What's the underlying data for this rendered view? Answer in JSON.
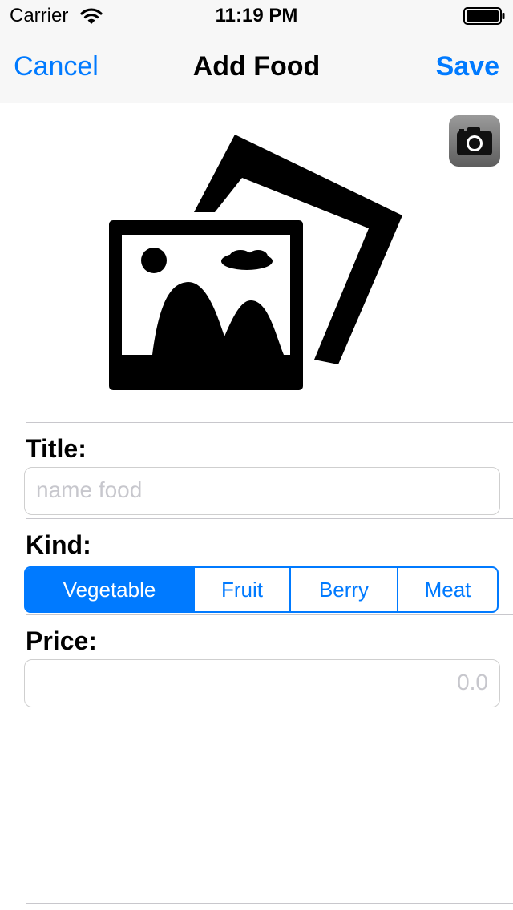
{
  "status_bar": {
    "carrier": "Carrier",
    "time": "11:19 PM",
    "icons": [
      "wifi-icon",
      "battery-icon"
    ]
  },
  "nav": {
    "cancel_label": "Cancel",
    "title": "Add Food",
    "save_label": "Save"
  },
  "photo": {
    "placeholder_icon": "photo-placeholder-icon",
    "camera_icon": "camera-icon"
  },
  "form": {
    "title_label": "Title:",
    "title_value": "",
    "title_placeholder": "name food",
    "kind_label": "Kind:",
    "kind_options": [
      "Vegetable",
      "Fruit",
      "Berry",
      "Meat"
    ],
    "kind_selected": "Vegetable",
    "price_label": "Price:",
    "price_value": "",
    "price_placeholder": "0.0"
  },
  "colors": {
    "accent": "#007aff",
    "bar_background": "#f7f7f7",
    "separator": "#c8c7cc",
    "placeholder_text": "#c7c7cd"
  }
}
